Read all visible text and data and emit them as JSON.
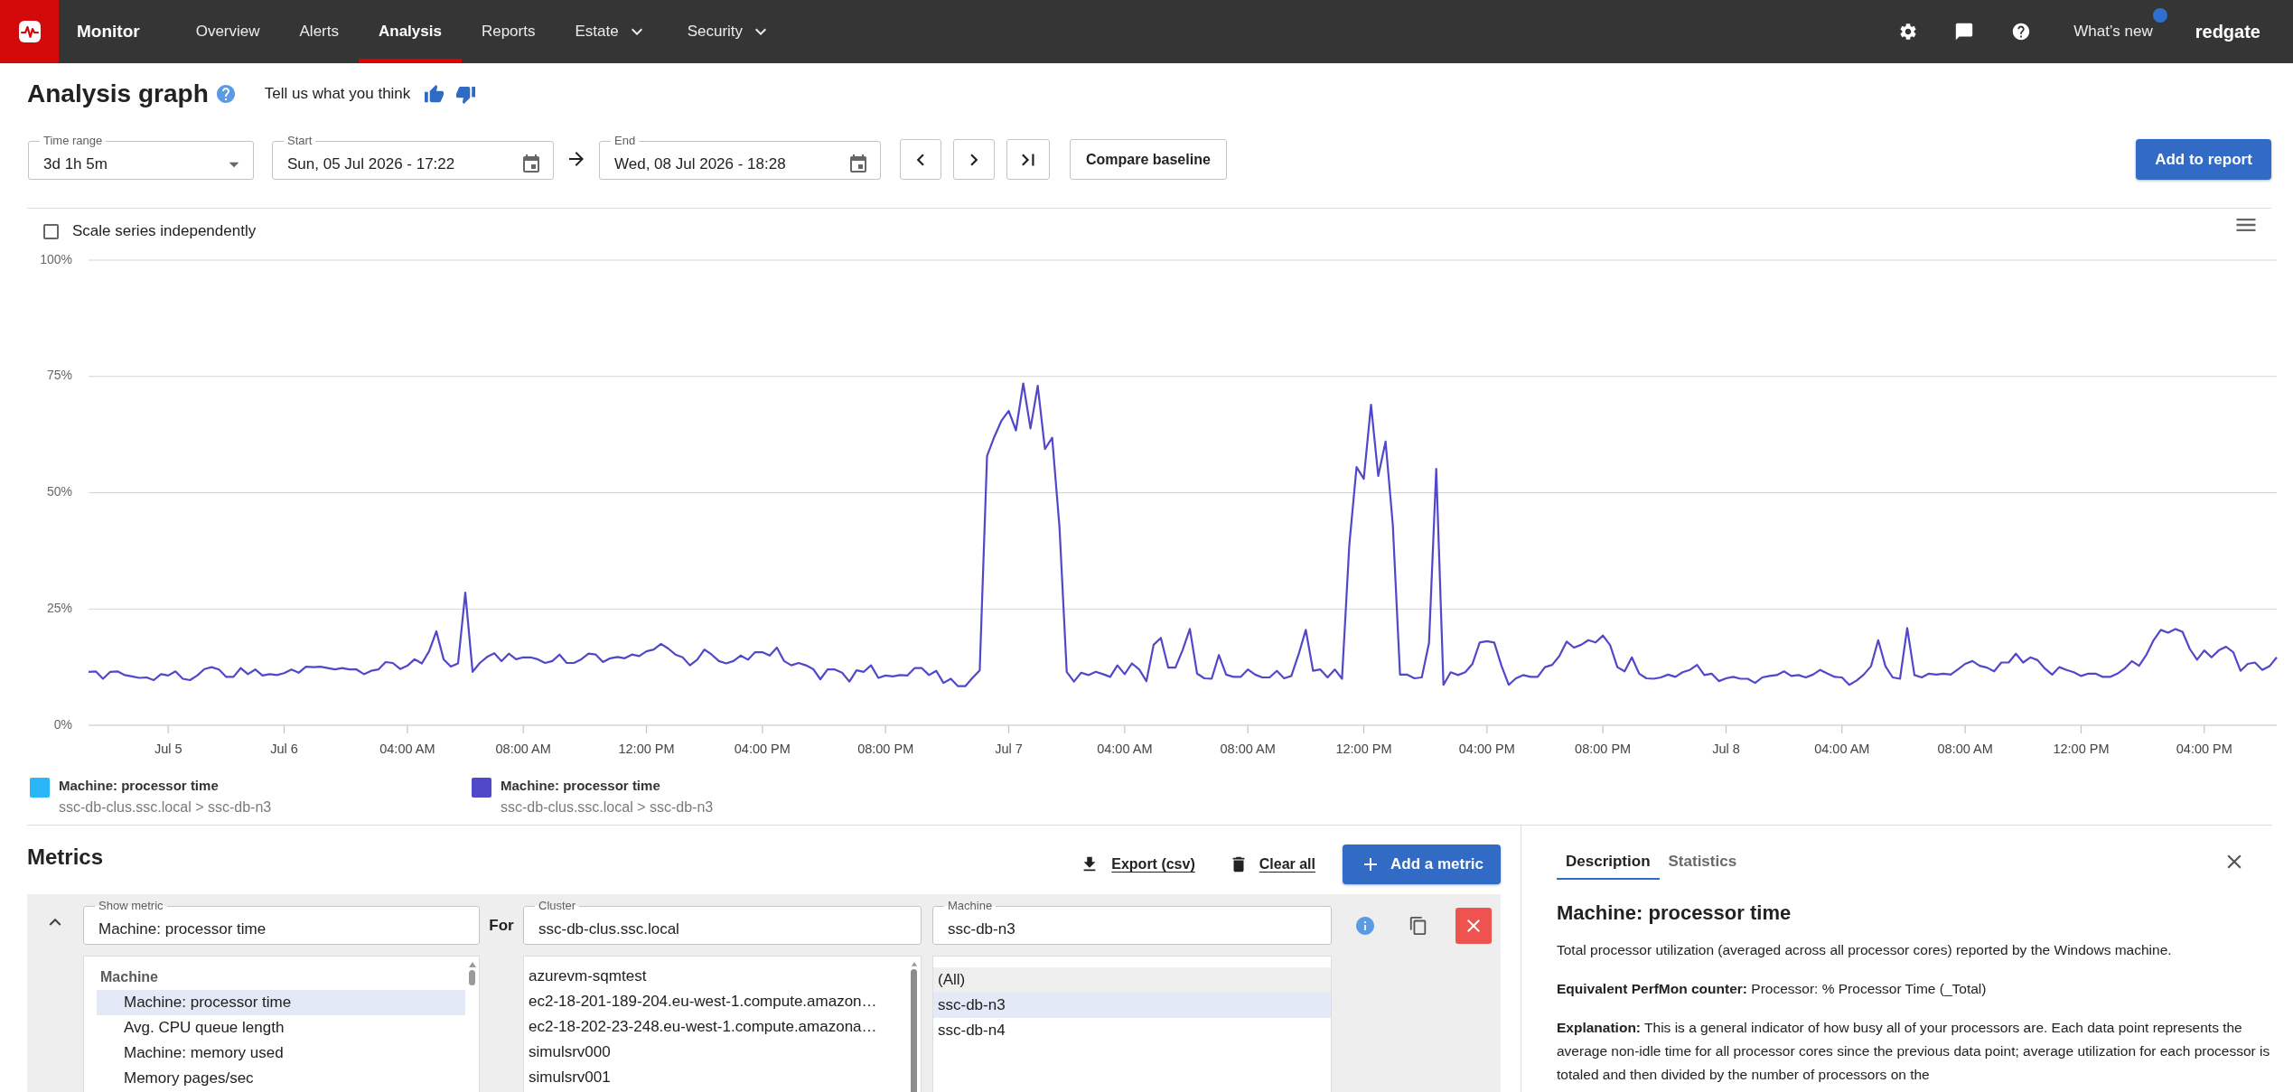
{
  "header": {
    "product": "Monitor",
    "nav": [
      {
        "label": "Overview",
        "selected": false,
        "dropdown": false
      },
      {
        "label": "Alerts",
        "selected": false,
        "dropdown": false
      },
      {
        "label": "Analysis",
        "selected": true,
        "dropdown": false
      },
      {
        "label": "Reports",
        "selected": false,
        "dropdown": false
      },
      {
        "label": "Estate",
        "selected": false,
        "dropdown": true
      },
      {
        "label": "Security",
        "selected": false,
        "dropdown": true
      }
    ],
    "whats_new": {
      "label": "What’s new",
      "unread": true
    },
    "brand": "redgate"
  },
  "page": {
    "title": "Analysis graph",
    "feedback_prompt": "Tell us what you think"
  },
  "time_controls": {
    "time_range": {
      "label": "Time range",
      "value": "3d 1h 5m"
    },
    "start": {
      "label": "Start",
      "value": "Sun, 05 Jul 2026 - 17:22"
    },
    "end": {
      "label": "End",
      "value": "Wed, 08 Jul 2026 - 18:28"
    },
    "compare_button": "Compare baseline",
    "add_button": "Add to report"
  },
  "chart": {
    "scale_independently": {
      "label": "Scale series independently",
      "checked": false
    },
    "chart_data": {
      "type": "line",
      "grid": true,
      "ylim": [
        0,
        100
      ],
      "categories": [
        null,
        null,
        null,
        null,
        null,
        null,
        null,
        null,
        null,
        null,
        null,
        "Jul 5",
        null,
        null,
        null,
        null,
        null,
        null,
        null,
        null,
        null,
        null,
        null,
        null,
        null,
        null,
        null,
        "Jul 6",
        null,
        null,
        null,
        null,
        null,
        null,
        null,
        null,
        null,
        null,
        null,
        null,
        null,
        null,
        null,
        null,
        "04:00 AM",
        null,
        null,
        null,
        null,
        null,
        null,
        null,
        null,
        null,
        null,
        null,
        null,
        null,
        null,
        null,
        "08:00 AM",
        null,
        null,
        null,
        null,
        null,
        null,
        null,
        null,
        null,
        null,
        null,
        null,
        null,
        null,
        null,
        null,
        "12:00 PM",
        null,
        null,
        null,
        null,
        null,
        null,
        null,
        null,
        null,
        null,
        null,
        null,
        null,
        null,
        null,
        "04:00 PM",
        null,
        null,
        null,
        null,
        null,
        null,
        null,
        null,
        null,
        null,
        null,
        null,
        null,
        null,
        null,
        null,
        "08:00 PM",
        null,
        null,
        null,
        null,
        null,
        null,
        null,
        null,
        null,
        null,
        null,
        null,
        null,
        null,
        null,
        null,
        "Jul 7",
        null,
        null,
        null,
        null,
        null,
        null,
        null,
        null,
        null,
        null,
        null,
        null,
        null,
        null,
        null,
        "04:00 AM",
        null,
        null,
        null,
        null,
        null,
        null,
        null,
        null,
        null,
        null,
        null,
        null,
        null,
        null,
        null,
        null,
        "08:00 AM",
        null,
        null,
        null,
        null,
        null,
        null,
        null,
        null,
        null,
        null,
        null,
        null,
        null,
        null,
        null,
        "12:00 PM",
        null,
        null,
        null,
        null,
        null,
        null,
        null,
        null,
        null,
        null,
        null,
        null,
        null,
        null,
        null,
        null,
        "04:00 PM",
        null,
        null,
        null,
        null,
        null,
        null,
        null,
        null,
        null,
        null,
        null,
        null,
        null,
        null,
        null,
        "08:00 PM",
        null,
        null,
        null,
        null,
        null,
        null,
        null,
        null,
        null,
        null,
        null,
        null,
        null,
        null,
        null,
        null,
        "Jul 8",
        null,
        null,
        null,
        null,
        null,
        null,
        null,
        null,
        null,
        null,
        null,
        null,
        null,
        null,
        null,
        "04:00 AM",
        null,
        null,
        null,
        null,
        null,
        null,
        null,
        null,
        null,
        null,
        null,
        null,
        null,
        null,
        null,
        null,
        "08:00 AM",
        null,
        null,
        null,
        null,
        null,
        null,
        null,
        null,
        null,
        null,
        null,
        null,
        null,
        null,
        null,
        "12:00 PM",
        null,
        null,
        null,
        null,
        null,
        null,
        null,
        null,
        null,
        null,
        null,
        null,
        null,
        null,
        null,
        null,
        "04:00 PM",
        null,
        null,
        null,
        null,
        null,
        null,
        null,
        null,
        null,
        null
      ],
      "series": [
        {
          "color": "#5048c9",
          "values": [
            11.5,
            11.6,
            10,
            11.5,
            11.6,
            10.8,
            10.5,
            10.2,
            10.3,
            9.7,
            11,
            10.7,
            11.6,
            10,
            9.7,
            10.7,
            12.1,
            12.5,
            12,
            10.4,
            10.4,
            12.3,
            11,
            12,
            10.7,
            11,
            10.8,
            11.2,
            12,
            11.3,
            12.6,
            12.5,
            12.6,
            12.3,
            12,
            12.3,
            12,
            12,
            11,
            11.7,
            12,
            13.6,
            13.4,
            12.1,
            12.8,
            14.2,
            13.3,
            15.9,
            20.2,
            14.2,
            12.6,
            13.3,
            28.5,
            11.5,
            13.4,
            14.7,
            15.5,
            13.8,
            15.4,
            14.2,
            14.6,
            14.6,
            14.2,
            13.4,
            13.8,
            15.2,
            13.4,
            13.4,
            14.2,
            15.4,
            15.2,
            13.6,
            14.4,
            14.7,
            14.4,
            15.2,
            14.9,
            15.9,
            16.3,
            17.5,
            16.5,
            15.2,
            14.6,
            12.9,
            14.1,
            16.3,
            15.2,
            13.8,
            13.3,
            13.8,
            15,
            14.1,
            15.7,
            15.7,
            15,
            16.7,
            13.8,
            12.9,
            13.4,
            12.9,
            12.1,
            9.9,
            12,
            12,
            11.3,
            9.4,
            11.8,
            11.5,
            12.9,
            10.2,
            10.7,
            10.5,
            10.8,
            10.7,
            12.3,
            12.3,
            10.8,
            11.7,
            9.1,
            10,
            8.4,
            8.4,
            10.2,
            11.8,
            57.9,
            62,
            65.5,
            67.6,
            63.4,
            73.5,
            63.8,
            73,
            59.4,
            61.8,
            42.6,
            11.5,
            9.4,
            11.3,
            10.8,
            11.5,
            11,
            10.4,
            12.9,
            11,
            13.3,
            12,
            9.5,
            17.3,
            18.8,
            12.4,
            12.4,
            16.2,
            20.7,
            11.1,
            10.1,
            10,
            15.1,
            10.9,
            10.4,
            10.4,
            12,
            10.9,
            10.3,
            10.3,
            11.7,
            10.1,
            10.6,
            15.2,
            20.5,
            11.7,
            12,
            10.3,
            12,
            10,
            38.8,
            55.5,
            53,
            68.9,
            53.6,
            61,
            43.2,
            10.9,
            10.9,
            10.1,
            10.3,
            17.7,
            55.1,
            8.7,
            11.4,
            10.8,
            11.4,
            13.2,
            17.8,
            18.1,
            17.8,
            12.8,
            8.7,
            10.1,
            10.8,
            10.4,
            10.4,
            12.5,
            13,
            14.9,
            18,
            16.7,
            17.3,
            18.3,
            17.8,
            19.3,
            17.2,
            12.5,
            11.6,
            14.6,
            11.1,
            10.1,
            10,
            10.3,
            10.9,
            10.4,
            11.4,
            11.9,
            13,
            10.8,
            11.1,
            9.5,
            10.1,
            10.4,
            10,
            10,
            9.1,
            10.3,
            10.6,
            10.8,
            11.6,
            10.6,
            10.8,
            10.3,
            10.9,
            11.9,
            11.1,
            10.4,
            10.3,
            8.7,
            9.6,
            10.9,
            12.7,
            18.3,
            12.7,
            10.3,
            10,
            20.9,
            10.8,
            10.3,
            11.1,
            10.9,
            11.1,
            10.9,
            12,
            13.2,
            13.8,
            12.8,
            12.4,
            11.6,
            13.5,
            13.5,
            15.4,
            13.5,
            14.6,
            14,
            12.2,
            10.9,
            12.5,
            11.9,
            11.4,
            10.6,
            11.1,
            11.1,
            10.4,
            10.4,
            11.1,
            12.2,
            13.8,
            12.8,
            15.1,
            18.3,
            20.5,
            19.9,
            20.7,
            20.1,
            16.4,
            14.1,
            16.1,
            14.6,
            16.1,
            16.9,
            15.7,
            11.7,
            13.2,
            13.5,
            11.9,
            12.7,
            14.6
          ]
        }
      ],
      "yticks": [
        {
          "value": 0,
          "label": "0%"
        },
        {
          "value": 25,
          "label": "25%"
        },
        {
          "value": 50,
          "label": "50%"
        },
        {
          "value": 75,
          "label": "75%"
        },
        {
          "value": 100,
          "label": "100%"
        }
      ]
    },
    "legend": [
      {
        "name": "Machine: processor time",
        "source": "ssc-db-clus.ssc.local > ssc-db-n3",
        "color": "#29b6f6"
      },
      {
        "name": "Machine: processor time",
        "source": "ssc-db-clus.ssc.local > ssc-db-n3",
        "color": "#5048c9"
      }
    ]
  },
  "metrics": {
    "title": "Metrics",
    "export_label": "Export (csv)",
    "clear_label": "Clear all",
    "add_label": "Add a metric",
    "rows": [
      {
        "expanded": true,
        "metric": {
          "label": "Show metric",
          "value": "Machine: processor time"
        },
        "for_label": "For",
        "cluster": {
          "label": "Cluster",
          "value": "ssc-db-clus.ssc.local"
        },
        "machine": {
          "label": "Machine",
          "value": "ssc-db-n3"
        },
        "metric_groups": [
          {
            "name": "Machine",
            "items": [
              {
                "label": "Machine: processor time",
                "selected": true
              },
              {
                "label": "Avg. CPU queue length",
                "selected": false
              },
              {
                "label": "Machine: memory used",
                "selected": false
              },
              {
                "label": "Memory pages/sec",
                "selected": false
              }
            ]
          }
        ],
        "clusters": [
          {
            "label": "azurevm-sqmtest",
            "selected": false
          },
          {
            "label": "ec2-18-201-189-204.eu-west-1.compute.amazon…",
            "selected": false
          },
          {
            "label": "ec2-18-202-23-248.eu-west-1.compute.amazona…",
            "selected": false
          },
          {
            "label": "simulsrv000",
            "selected": false
          },
          {
            "label": "simulsrv001",
            "selected": false
          }
        ],
        "machines": [
          {
            "label": "(All)",
            "selected": false,
            "hovered": true
          },
          {
            "label": "ssc-db-n3",
            "selected": true,
            "hovered": false
          },
          {
            "label": "ssc-db-n4",
            "selected": false,
            "hovered": false
          }
        ]
      }
    ]
  },
  "details": {
    "tabs": [
      {
        "label": "Description",
        "selected": true
      },
      {
        "label": "Statistics",
        "selected": false
      }
    ],
    "title": "Machine: processor time",
    "paragraphs": [
      "Total processor utilization (averaged across all processor cores) reported by the Windows machine.",
      "**Equivalent PerfMon counter:** Processor: % Processor Time (_Total)",
      "**Explanation:** This is a general indicator of how busy all of your processors are. Each data point represents the average non-idle time for all processor cores since the previous data point; average utilization for each processor is totaled and then divided by the number of processors on the"
    ]
  }
}
